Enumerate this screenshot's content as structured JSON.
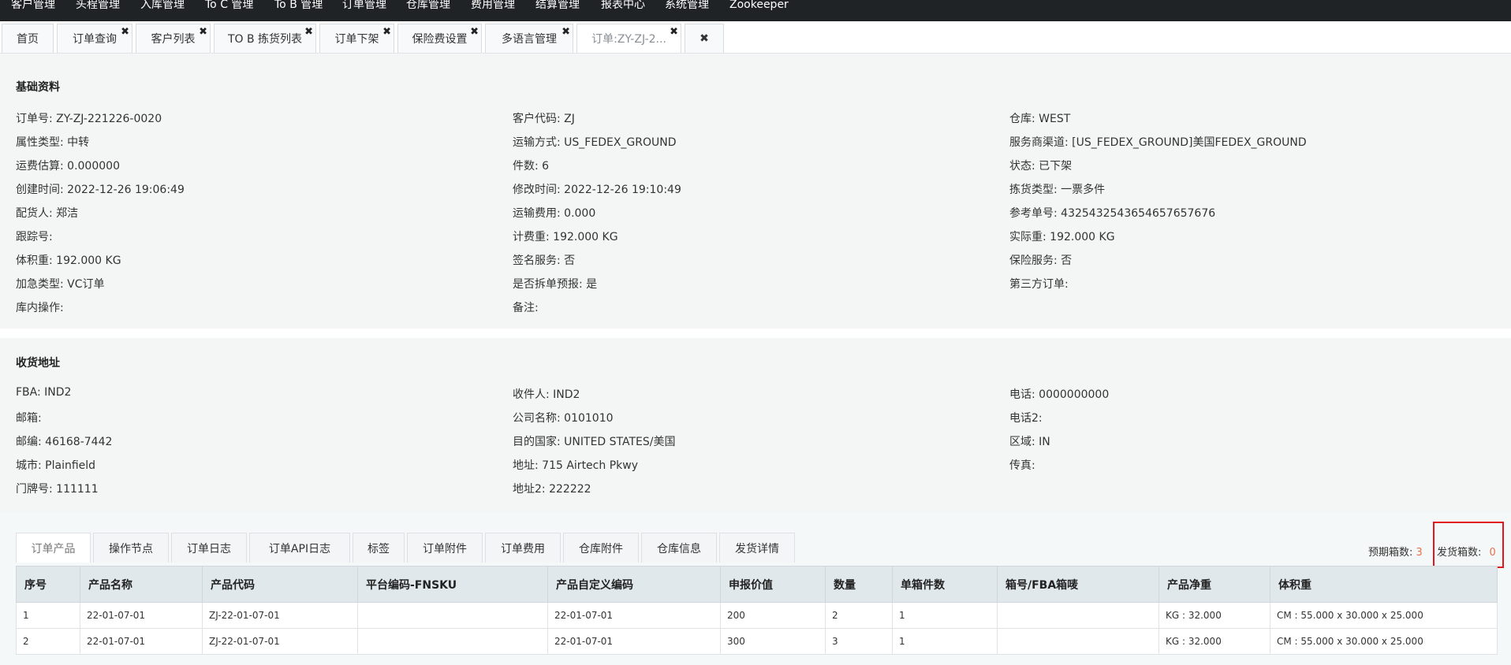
{
  "topnav": [
    "客户管理",
    "头程管理",
    "入库管理",
    "To C 管理",
    "To B 管理",
    "订单管理",
    "仓库管理",
    "费用管理",
    "结算管理",
    "报表中心",
    "系统管理",
    "Zookeeper"
  ],
  "tabs": [
    {
      "label": "首页",
      "closable": false
    },
    {
      "label": "订单查询",
      "closable": true
    },
    {
      "label": "客户列表",
      "closable": true
    },
    {
      "label": "TO B 拣货列表",
      "closable": true
    },
    {
      "label": "订单下架",
      "closable": true
    },
    {
      "label": "保险费设置",
      "closable": true
    },
    {
      "label": "多语言管理",
      "closable": true
    },
    {
      "label": "订单:ZY-ZJ-2...",
      "closable": true
    },
    {
      "label": "✖",
      "closable": false
    }
  ],
  "basic": {
    "title": "基础资料",
    "col1": [
      {
        "label": "订单号",
        "value": "ZY-ZJ-221226-0020"
      },
      {
        "label": "属性类型",
        "value": "中转"
      },
      {
        "label": "运费估算",
        "value": "0.000000"
      },
      {
        "label": "创建时间",
        "value": "2022-12-26 19:06:49"
      },
      {
        "label": "配货人",
        "value": "郑洁"
      },
      {
        "label": "跟踪号",
        "value": ""
      },
      {
        "label": "体积重",
        "value": "192.000 KG"
      },
      {
        "label": "加急类型",
        "value": "VC订单"
      },
      {
        "label": "库内操作",
        "value": ""
      }
    ],
    "col2": [
      {
        "label": "客户代码",
        "value": "ZJ"
      },
      {
        "label": "运输方式",
        "value": "US_FEDEX_GROUND"
      },
      {
        "label": "件数",
        "value": "6"
      },
      {
        "label": "修改时间",
        "value": "2022-12-26 19:10:49"
      },
      {
        "label": "运输费用",
        "value": "0.000"
      },
      {
        "label": "计费重",
        "value": "192.000 KG"
      },
      {
        "label": "签名服务",
        "value": "否"
      },
      {
        "label": "是否拆单预报",
        "value": "是"
      },
      {
        "label": "备注",
        "value": ""
      }
    ],
    "col3": [
      {
        "label": "仓库",
        "value": "WEST"
      },
      {
        "label": "服务商渠道",
        "value": "[US_FEDEX_GROUND]美国FEDEX_GROUND"
      },
      {
        "label": "状态",
        "value": "已下架"
      },
      {
        "label": "拣货类型",
        "value": "一票多件"
      },
      {
        "label": "参考单号",
        "value": "4325432543654657657676"
      },
      {
        "label": "实际重",
        "value": "192.000 KG"
      },
      {
        "label": "保险服务",
        "value": "否"
      },
      {
        "label": "第三方订单",
        "value": ""
      }
    ]
  },
  "address": {
    "title": "收货地址",
    "col1": [
      {
        "label": "FBA",
        "value": "IND2"
      },
      {
        "label": "邮箱",
        "value": ""
      },
      {
        "label": "邮编",
        "value": "46168-7442"
      },
      {
        "label": "城市",
        "value": "Plainfield"
      },
      {
        "label": "门牌号",
        "value": "111111"
      }
    ],
    "col2": [
      {
        "label": "收件人",
        "value": "IND2"
      },
      {
        "label": "公司名称",
        "value": "0101010"
      },
      {
        "label": "目的国家",
        "value": "UNITED STATES/美国"
      },
      {
        "label": "地址",
        "value": "715 Airtech Pkwy"
      },
      {
        "label": "地址2",
        "value": "222222"
      }
    ],
    "col3": [
      {
        "label": "电话",
        "value": "0000000000"
      },
      {
        "label": "电话2",
        "value": ""
      },
      {
        "label": "区域",
        "value": "IN"
      },
      {
        "label": "传真",
        "value": ""
      }
    ]
  },
  "detail_tabs": [
    "订单产品",
    "操作节点",
    "订单日志",
    "订单API日志",
    "标签",
    "订单附件",
    "订单费用",
    "仓库附件",
    "仓库信息",
    "发货详情"
  ],
  "box_counts": {
    "expected_label": "预期箱数:",
    "expected_value": "3",
    "shipped_label": "发货箱数:",
    "shipped_value": "0"
  },
  "table": {
    "headers": [
      "序号",
      "产品名称",
      "产品代码",
      "平台编码-FNSKU",
      "产品自定义编码",
      "申报价值",
      "数量",
      "单箱件数",
      "箱号/FBA箱唛",
      "产品净重",
      "体积重"
    ],
    "rows": [
      [
        "1",
        "22-01-07-01",
        "ZJ-22-01-07-01",
        "",
        "22-01-07-01",
        "200",
        "2",
        "1",
        "",
        "KG : 32.000",
        "CM : 55.000 x 30.000 x 25.000"
      ],
      [
        "2",
        "22-01-07-01",
        "ZJ-22-01-07-01",
        "",
        "22-01-07-01",
        "300",
        "3",
        "1",
        "",
        "KG : 32.000",
        "CM : 55.000 x 30.000 x 25.000"
      ]
    ]
  }
}
